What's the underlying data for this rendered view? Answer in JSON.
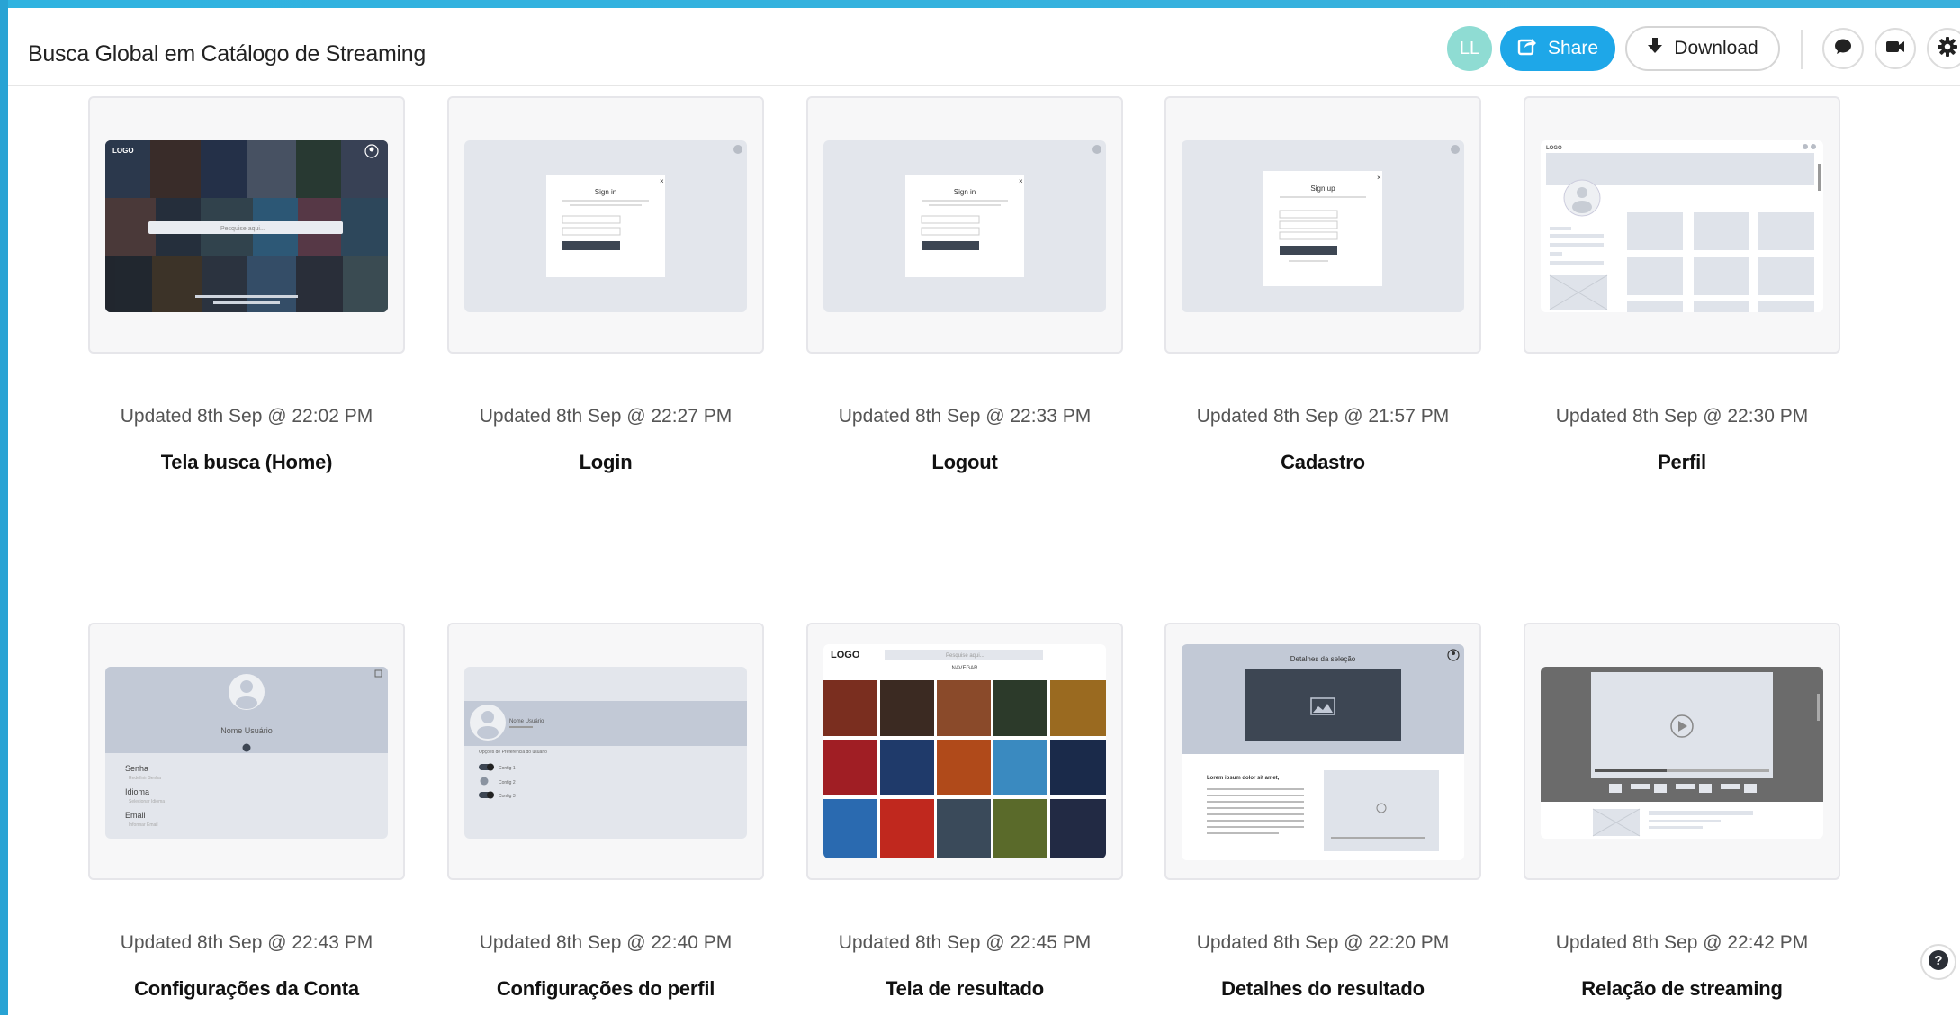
{
  "header": {
    "title": "Busca Global em Catálogo de Streaming",
    "avatar_initials": "LL",
    "share_label": "Share",
    "download_label": "Download",
    "icons": [
      "comment-icon",
      "video-icon",
      "gear-icon"
    ]
  },
  "colors": {
    "accent": "#1ea7e8",
    "avatar": "#8fdcd3",
    "frame": "#2aa6d6"
  },
  "screens": [
    {
      "updated": "Updated 8th Sep @ 22:02 PM",
      "name": "Tela busca (Home)"
    },
    {
      "updated": "Updated 8th Sep @ 22:27 PM",
      "name": "Login"
    },
    {
      "updated": "Updated 8th Sep @ 22:33 PM",
      "name": "Logout"
    },
    {
      "updated": "Updated 8th Sep @ 21:57 PM",
      "name": "Cadastro"
    },
    {
      "updated": "Updated 8th Sep @ 22:30 PM",
      "name": "Perfil"
    },
    {
      "updated": "Updated 8th Sep @ 22:43 PM",
      "name": "Configurações da Conta"
    },
    {
      "updated": "Updated 8th Sep @ 22:40 PM",
      "name": "Configurações do perfil"
    },
    {
      "updated": "Updated 8th Sep @ 22:45 PM",
      "name": "Tela de resultado"
    },
    {
      "updated": "Updated 8th Sep @ 22:20 PM",
      "name": "Detalhes do resultado"
    },
    {
      "updated": "Updated 8th Sep @ 22:42 PM",
      "name": "Relação de streaming"
    }
  ],
  "thumbnails": {
    "home": {
      "logo": "LOGO",
      "search_placeholder": "Pesquise aqui..."
    },
    "login": {
      "heading": "Sign in"
    },
    "logout": {
      "heading": "Sign in"
    },
    "signup": {
      "heading": "Sign up"
    },
    "profile": {
      "logo": "LOGO"
    },
    "account": {
      "user_name": "Nome Usuário",
      "fields": [
        "Senha",
        "Idioma",
        "Email"
      ],
      "field_hints": [
        "Redefinir Senha",
        "Selecionar Idioma",
        "Informar Email"
      ]
    },
    "profile_settings": {
      "user_name": "Nome Usuário",
      "section": "Opções de Preferência do usuário",
      "options": [
        "Config 1",
        "Config 2",
        "Config 3"
      ]
    },
    "results": {
      "logo": "LOGO",
      "search_placeholder": "Pesquise aqui...",
      "nav": "NAVEGAR"
    },
    "details": {
      "heading": "Detalhes da seleção",
      "text_title": "Lorem ipsum dolor sit amet,"
    }
  }
}
